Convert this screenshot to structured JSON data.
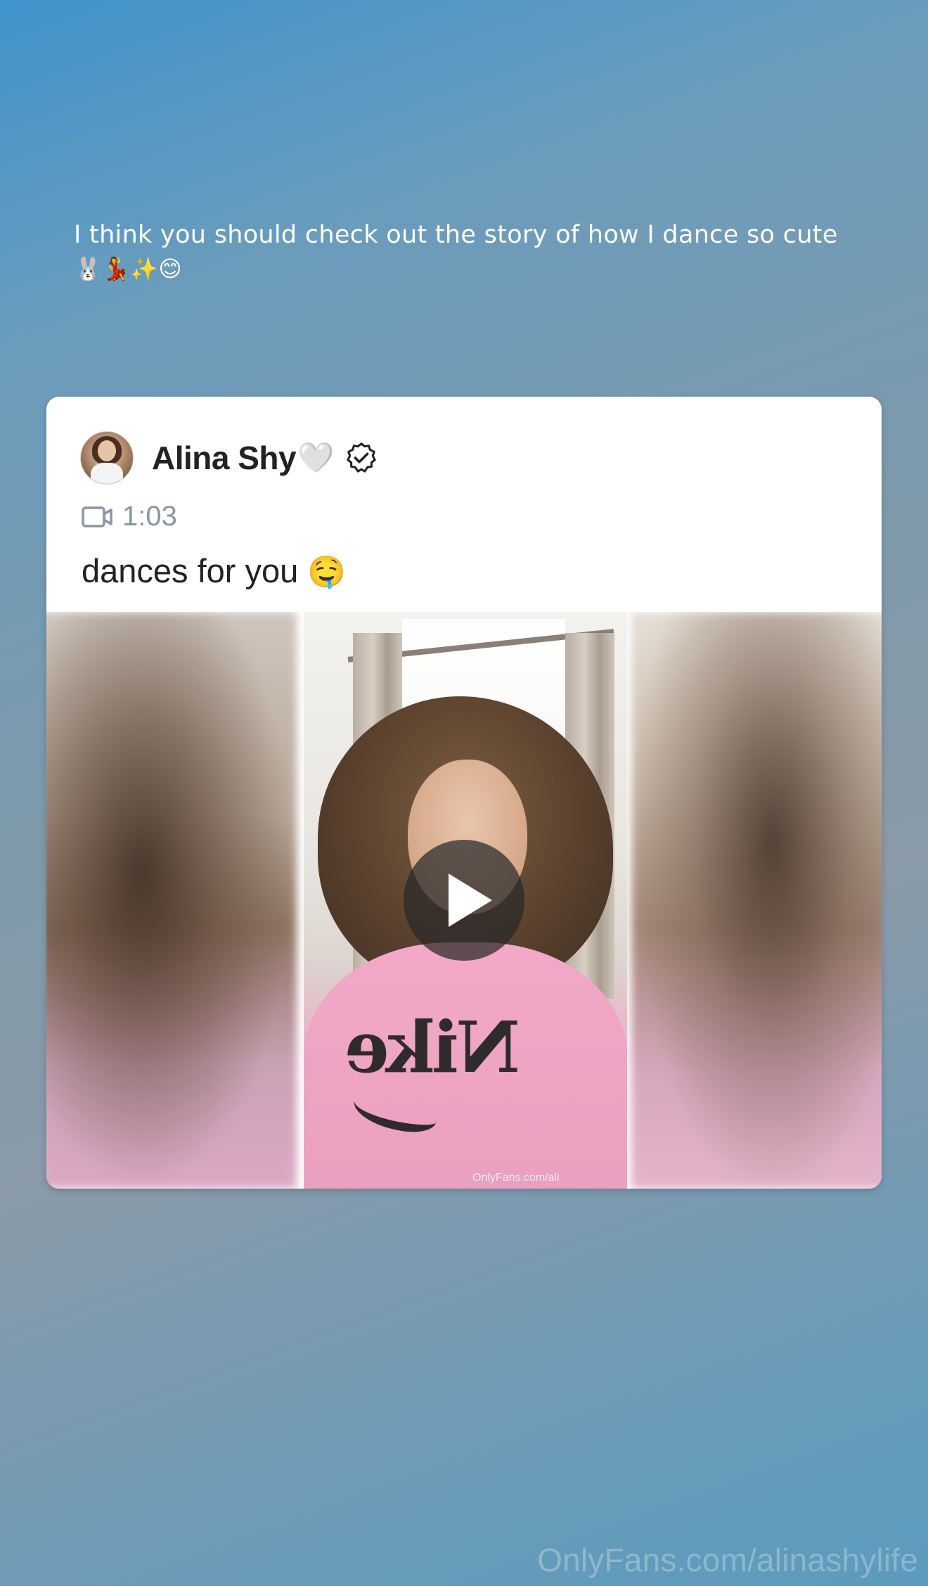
{
  "story": {
    "caption_line1": "I think you should check out the story of how I dance so cute",
    "caption_line2": "🐰💃✨😊"
  },
  "post": {
    "author_name": "Alina Shy",
    "author_heart": "🤍",
    "verified_icon": "verified-badge-icon",
    "media_type_icon": "video-camera-icon",
    "duration": "1:03",
    "text": "dances for you",
    "text_emoji": "🤤",
    "media_watermark": "OnlyFans.com/ali",
    "play_icon": "play-icon"
  },
  "watermark": "OnlyFans.com/alinashylife",
  "colors": {
    "background_top": "#3f93cc",
    "background_bottom": "#5b9bbd",
    "card_bg": "#ffffff",
    "name_color": "#222222",
    "meta_color": "#8a96a3"
  }
}
